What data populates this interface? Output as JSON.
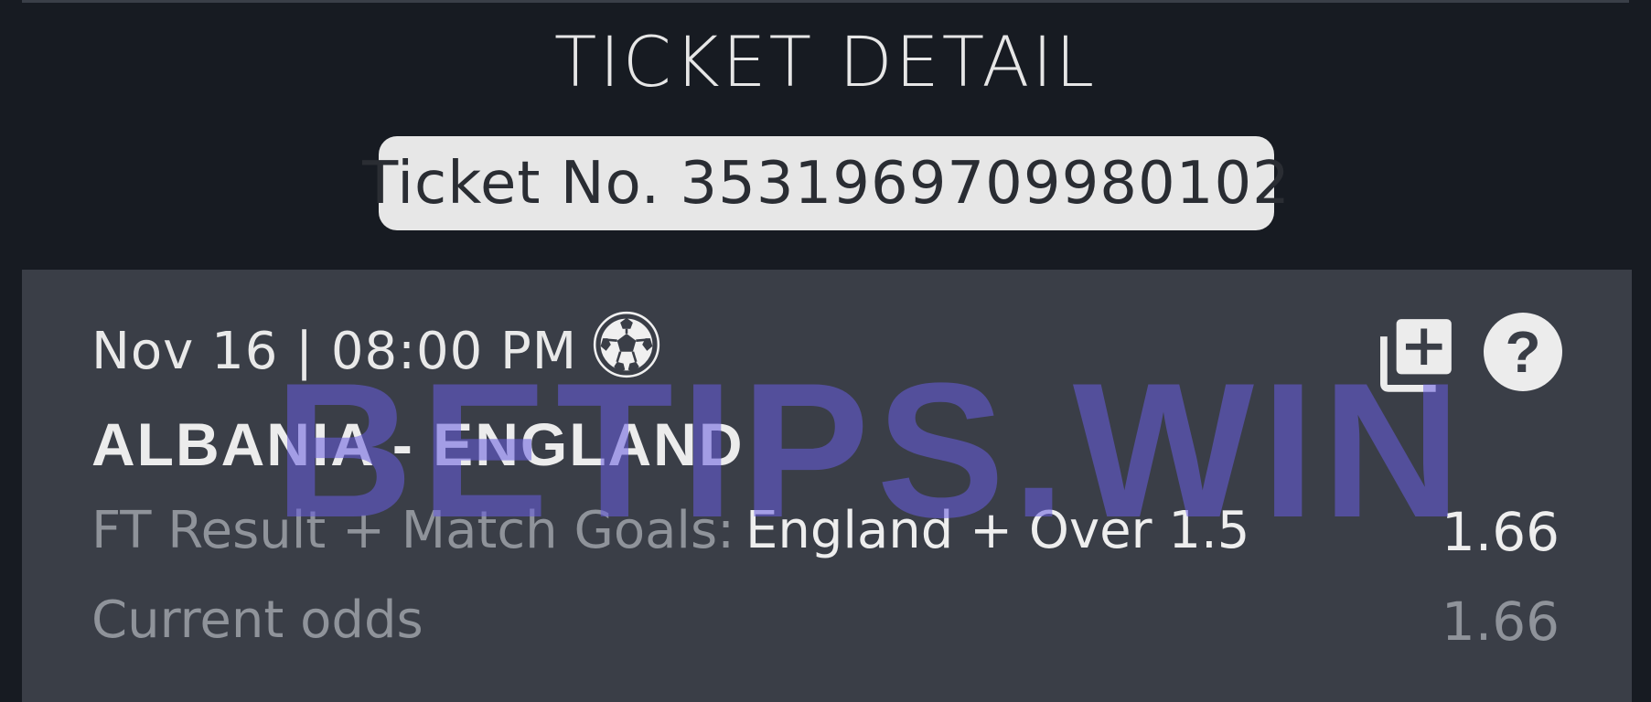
{
  "header": {
    "title": "TICKET DETAIL",
    "ticket_number": "Ticket No. 3531969709980102"
  },
  "event": {
    "datetime": "Nov 16 | 08:00 PM",
    "sport_icon": "soccer-ball-icon",
    "match": "ALBANIA - ENGLAND",
    "market_label": "FT Result + Match Goals:",
    "selection": "England + Over 1.5",
    "odds": "1.66",
    "current_odds_label": "Current odds",
    "current_odds": "1.66",
    "actions": {
      "add_icon": "add-to-slip-icon",
      "help_icon": "help-icon",
      "help_symbol": "?"
    }
  },
  "watermark": {
    "text": "BETIPS.WIN"
  },
  "colors": {
    "background": "#171b22",
    "card": "#3a3e47",
    "pill": "#e7e7e7",
    "muted_text": "#8f939a",
    "watermark": "#675ce0"
  }
}
